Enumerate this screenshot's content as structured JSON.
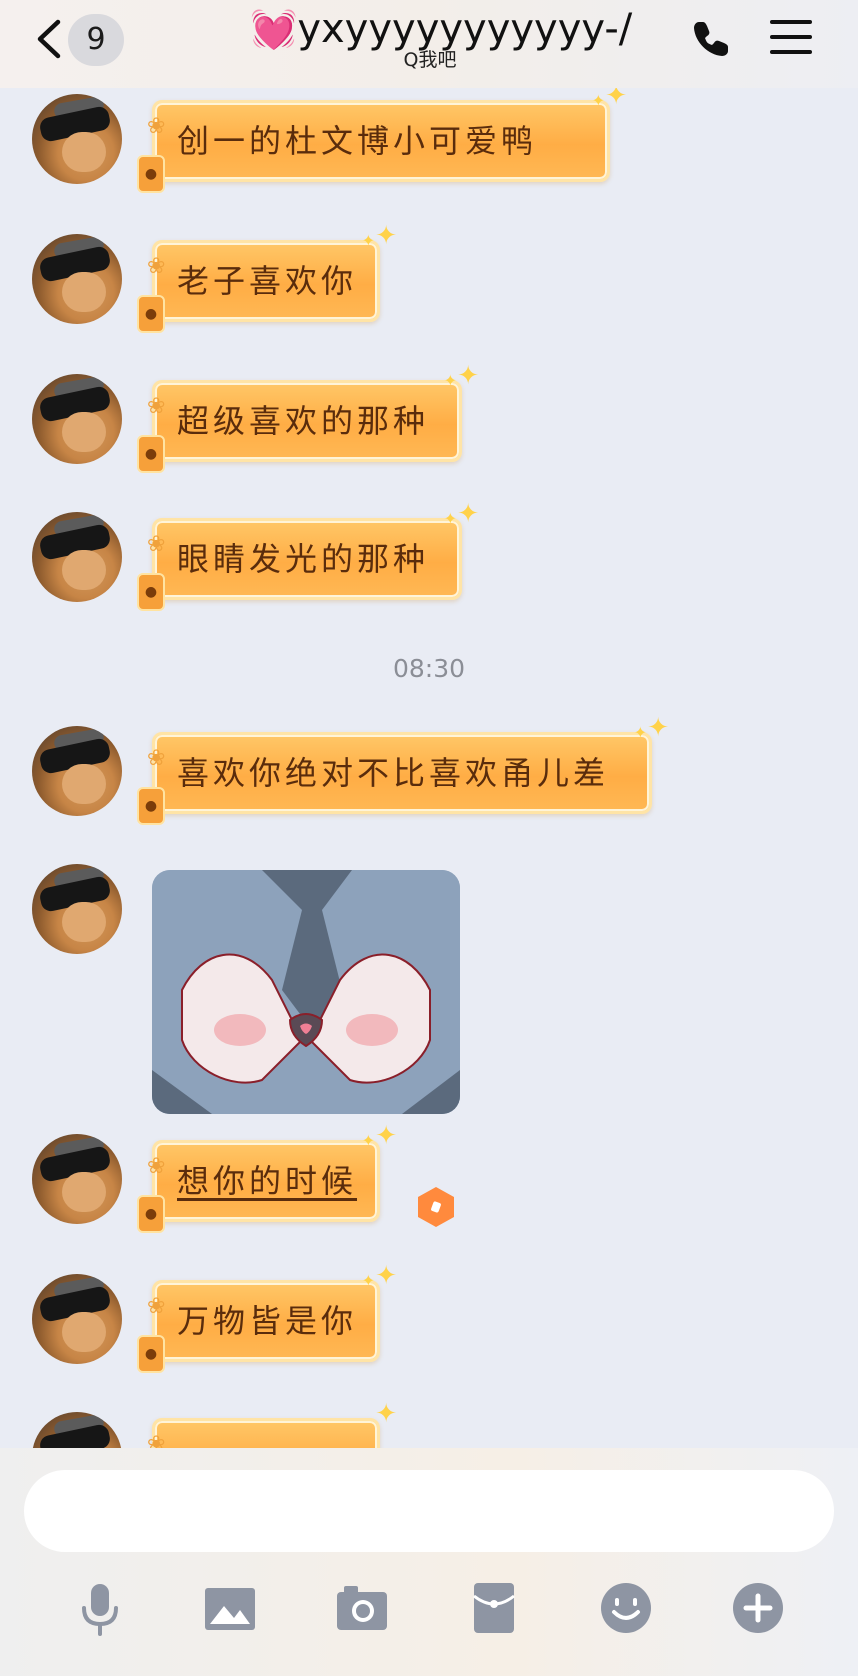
{
  "header": {
    "back_count": "9",
    "title_heart": "💓",
    "title": "yxyyyyyyyyyyy-/",
    "subtitle": "Q我吧"
  },
  "messages": [
    {
      "type": "text",
      "text": "创一的杜文博小可爱鸭"
    },
    {
      "type": "text",
      "text": "老子喜欢你"
    },
    {
      "type": "text",
      "text": "超级喜欢的那种"
    },
    {
      "type": "text",
      "text": "眼睛发光的那种"
    },
    {
      "type": "time",
      "text": "08:30"
    },
    {
      "type": "text",
      "text": "喜欢你绝对不比喜欢甬儿差"
    },
    {
      "type": "sticker",
      "name": "hand-heart-sticker"
    },
    {
      "type": "text",
      "text": "想你的时候"
    },
    {
      "type": "text",
      "text": "万物皆是你"
    }
  ],
  "input": {
    "placeholder": "",
    "value": ""
  },
  "toolbar": [
    "mic-icon",
    "image-icon",
    "camera-icon",
    "red-packet-icon",
    "emoji-icon",
    "plus-icon"
  ],
  "colors": {
    "bubble": "#ffad45",
    "bubble_text": "#5a2c0c",
    "background": "#e9ecf4",
    "icon": "#8e95a3",
    "status_dot": "#ff8a3d"
  }
}
